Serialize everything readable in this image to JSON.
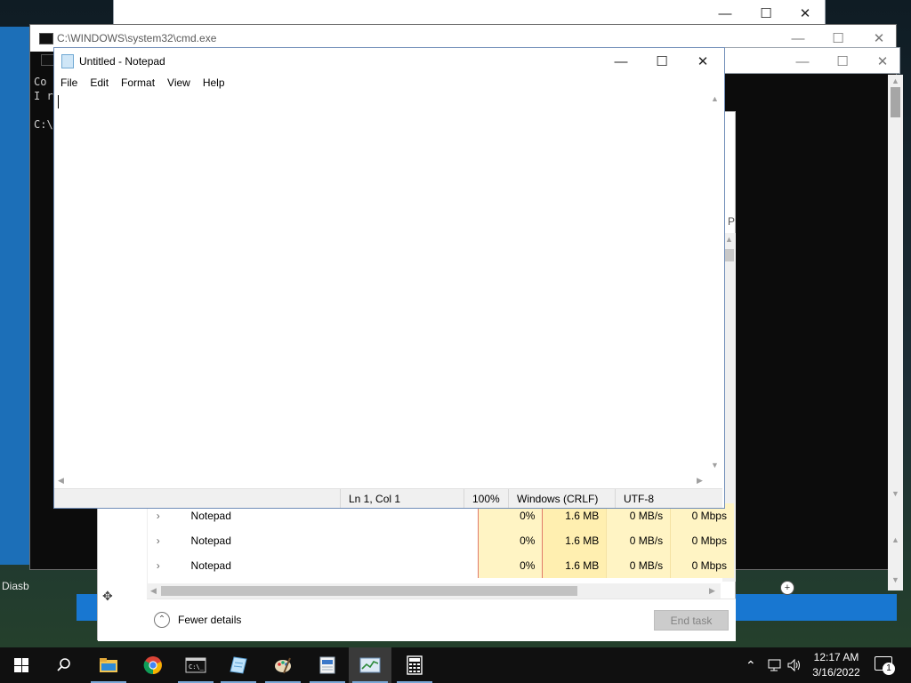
{
  "cmd": {
    "title": "C:\\WINDOWS\\system32\\cmd.exe",
    "lines": "Co\nI r\n\nC:\\"
  },
  "desktop": {
    "left_label": "Diasb"
  },
  "task_manager": {
    "rows": [
      {
        "name": "Notepad",
        "cpu": "0%",
        "memory": "1.6 MB",
        "disk": "0 MB/s",
        "network": "0 Mbps"
      },
      {
        "name": "Notepad",
        "cpu": "0%",
        "memory": "1.6 MB",
        "disk": "0 MB/s",
        "network": "0 Mbps"
      },
      {
        "name": "Notepad",
        "cpu": "0%",
        "memory": "1.6 MB",
        "disk": "0 MB/s",
        "network": "0 Mbps"
      }
    ],
    "header_fragment": "P",
    "fewer_details_label": "Fewer details",
    "end_task_label": "End task"
  },
  "notepad": {
    "title": "Untitled - Notepad",
    "menu": [
      "File",
      "Edit",
      "Format",
      "View",
      "Help"
    ],
    "content": "",
    "status": {
      "position": "Ln 1, Col 1",
      "zoom": "100%",
      "line_ending": "Windows (CRLF)",
      "encoding": "UTF-8"
    }
  },
  "taskbar": {
    "time": "12:17 AM",
    "date": "3/16/2022",
    "notification_count": "1",
    "items": [
      "start",
      "search",
      "file-explorer",
      "chrome",
      "cmd",
      "notepad",
      "paint",
      "document-app",
      "task-manager",
      "calculator"
    ]
  }
}
